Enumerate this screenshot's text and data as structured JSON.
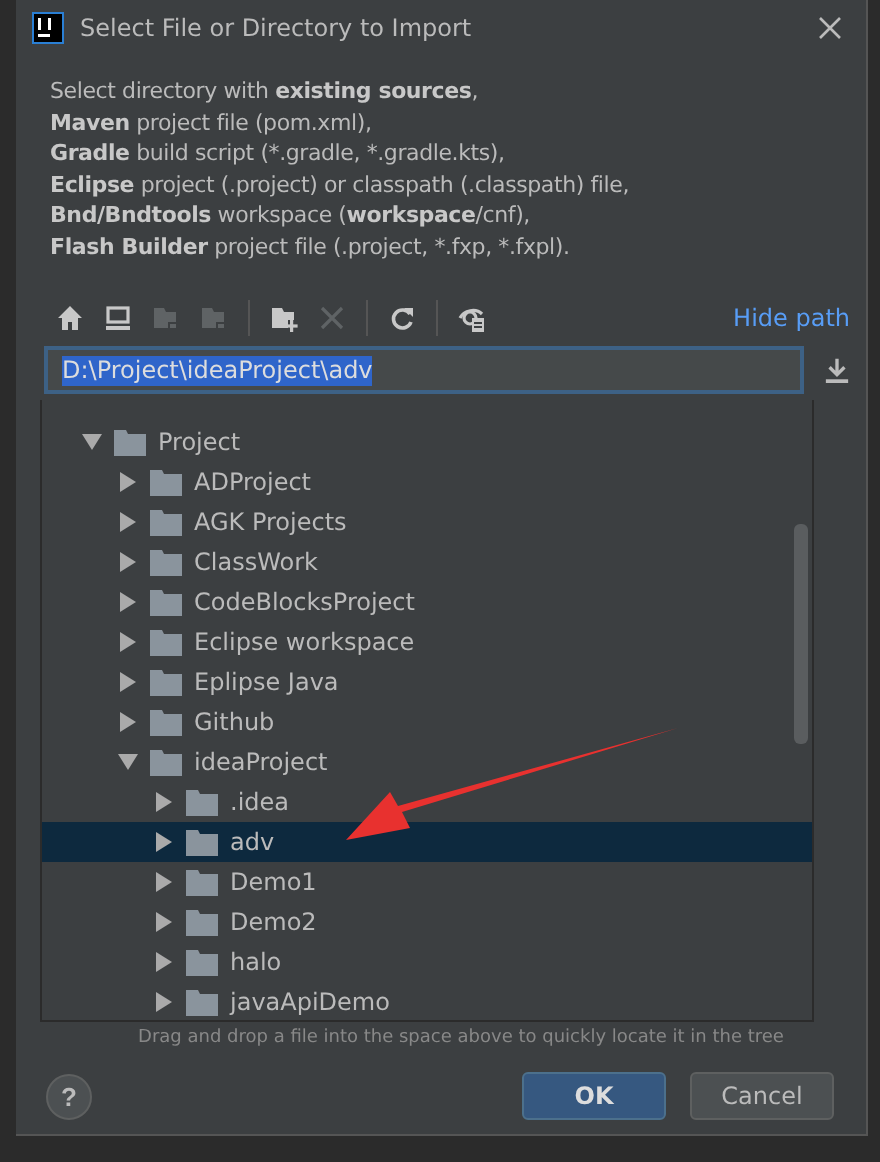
{
  "window": {
    "title": "Select File or Directory to Import"
  },
  "description": [
    "Select directory with **existing sources**,",
    "**Maven** project file (pom.xml),",
    "**Gradle** build script (*.gradle, *.gradle.kts),",
    "**Eclipse** project (.project) or classpath (.classpath) file,",
    "**Bnd/Bndtools** workspace (**workspace**/cnf),",
    "**Flash Builder** project file (.project, *.fxp, *.fxpl)."
  ],
  "toolbar": [
    {
      "kind": "home",
      "disabled": false
    },
    {
      "kind": "desktop",
      "disabled": false
    },
    {
      "kind": "folder",
      "disabled": true
    },
    {
      "kind": "folder",
      "disabled": true
    },
    {
      "kind": "separator"
    },
    {
      "kind": "new-folder",
      "disabled": false
    },
    {
      "kind": "delete",
      "disabled": true
    },
    {
      "kind": "separator"
    },
    {
      "kind": "refresh",
      "disabled": false
    },
    {
      "kind": "separator"
    },
    {
      "kind": "hidden",
      "disabled": false
    }
  ],
  "hide_path_link": "Hide path",
  "path": {
    "value": "D:\\Project\\ideaProject\\adv"
  },
  "tree": [
    {
      "label": "Project",
      "expanded": true,
      "selected": false,
      "children": [
        {
          "label": "ADProject",
          "expanded": false,
          "selected": false
        },
        {
          "label": "AGK Projects",
          "expanded": false,
          "selected": false
        },
        {
          "label": "ClassWork",
          "expanded": false,
          "selected": false
        },
        {
          "label": "CodeBlocksProject",
          "expanded": false,
          "selected": false
        },
        {
          "label": "Eclipse workspace",
          "expanded": false,
          "selected": false
        },
        {
          "label": "Eplipse Java",
          "expanded": false,
          "selected": false
        },
        {
          "label": "Github",
          "expanded": false,
          "selected": false
        },
        {
          "label": "ideaProject",
          "expanded": true,
          "selected": false,
          "children": [
            {
              "label": ".idea",
              "expanded": false,
              "selected": false
            },
            {
              "label": "adv",
              "expanded": false,
              "selected": true
            },
            {
              "label": "Demo1",
              "expanded": false,
              "selected": false
            },
            {
              "label": "Demo2",
              "expanded": false,
              "selected": false
            },
            {
              "label": "halo",
              "expanded": false,
              "selected": false
            },
            {
              "label": "javaApiDemo",
              "expanded": false,
              "selected": false
            }
          ]
        }
      ]
    }
  ],
  "hint": "Drag and drop a file into the space above to quickly locate it in the tree",
  "help_button": "?",
  "buttons": [
    {
      "label": "OK",
      "kind": "default"
    },
    {
      "label": "Cancel",
      "kind": "normal"
    }
  ]
}
